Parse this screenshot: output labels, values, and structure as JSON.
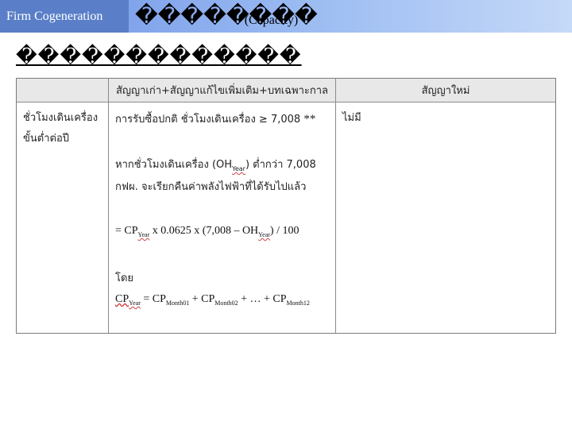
{
  "header": {
    "brand": "Firm Cogeneration",
    "title": "������",
    "title_tail": "��",
    "title_sub": "(Capacity)"
  },
  "heading": "�������������",
  "table": {
    "col_headers": [
      "สัญญาเก่า+สัญญาแก้ไขเพิ่มเติม+บทเฉพาะกาล",
      "สัญญาใหม่"
    ],
    "row_label_line1": "ชั่วโมงเดินเครื่อง",
    "row_label_line2": "ขั้นต่ำต่อปี",
    "line1": "การรับซื้อปกติ ชั่วโมงเดินเครื่อง ≥ 7,008",
    "stars": "**",
    "line2a": "หากชั่วโมงเดินเครื่อง (OH",
    "line2_sub": "Year",
    "line2b": ") ต่ำกว่า 7,008",
    "line3": "กฟผ. จะเรียกคืนค่าพลังไฟฟ้าที่ได้รับไปแล้ว",
    "formula_a": "= CP",
    "formula_sub1": "Year",
    "formula_b": " x 0.0625 x (7,008 – OH",
    "formula_sub2": "Year",
    "formula_c": ") / 100",
    "by": "โดย",
    "sum_a": "CP",
    "sum_sub0": "Year",
    "sum_b": " = CP",
    "sum_sub1": "Month01",
    "sum_c": " + CP",
    "sum_sub2": "Month02",
    "sum_d": " + … + CP",
    "sum_sub3": "Month12",
    "new_contract": "ไม่มี"
  }
}
